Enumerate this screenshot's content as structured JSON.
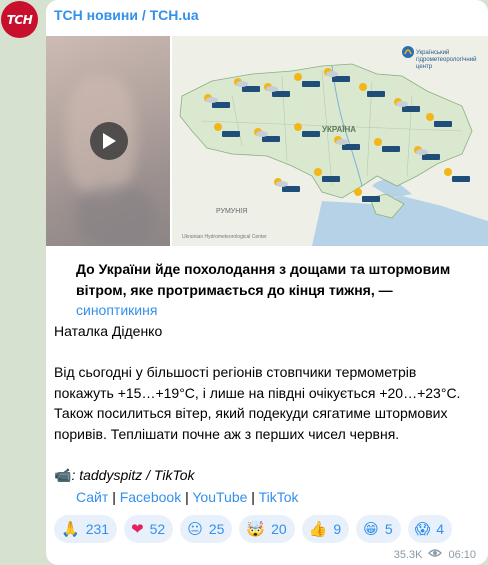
{
  "avatar": {
    "text": "ТСН",
    "color": "#c8102e"
  },
  "post": {
    "channel_name": "ТСН новини / TCH.ua",
    "video": {
      "play_icon": "play-icon"
    },
    "map": {
      "logo_text": "Український гідрометеорологічний центр",
      "country_label": "УКРАЇНА",
      "neighbor_label": "РУМУНІЯ",
      "footer": "Ukrainian Hydrometeorological Center"
    },
    "headline": "До України йде похолодання з дощами та штормовим вітром, яке протримається до кінця тижня, —",
    "headline_link": "синоптикиня",
    "author": "Наталка Діденко",
    "body": "Від сьогодні у більшості регіонів стовпчики термометрів покажуть +15…+19°С, і лише на півдні очікується +20…+23°С. Також посилиться вітер, який подекуди сягатиме штормових поривів. Теплішати почне аж з перших чисел червня.",
    "credit_icon": "camera-icon",
    "credit": ": taddyspitz / TikTok",
    "links": [
      "Сайт",
      "Facebook",
      "YouTube",
      "TikTok"
    ],
    "separator": "|",
    "reactions": [
      {
        "emoji": "🙏",
        "icon": "pray-icon",
        "count": "231"
      },
      {
        "emoji": "❤",
        "icon": "heart-icon",
        "count": "52"
      },
      {
        "emoji": "😐",
        "icon": "neutral-face-icon",
        "count": "25"
      },
      {
        "emoji": "🤯",
        "icon": "exploding-head-icon",
        "count": "20"
      },
      {
        "emoji": "👍",
        "icon": "thumbs-up-icon",
        "count": "9"
      },
      {
        "emoji": "😁",
        "icon": "grin-icon",
        "count": "5"
      },
      {
        "emoji": "😱",
        "icon": "scream-icon",
        "count": "4"
      }
    ],
    "views": "35.3K",
    "views_icon": "eye-icon",
    "time": "06:10"
  }
}
